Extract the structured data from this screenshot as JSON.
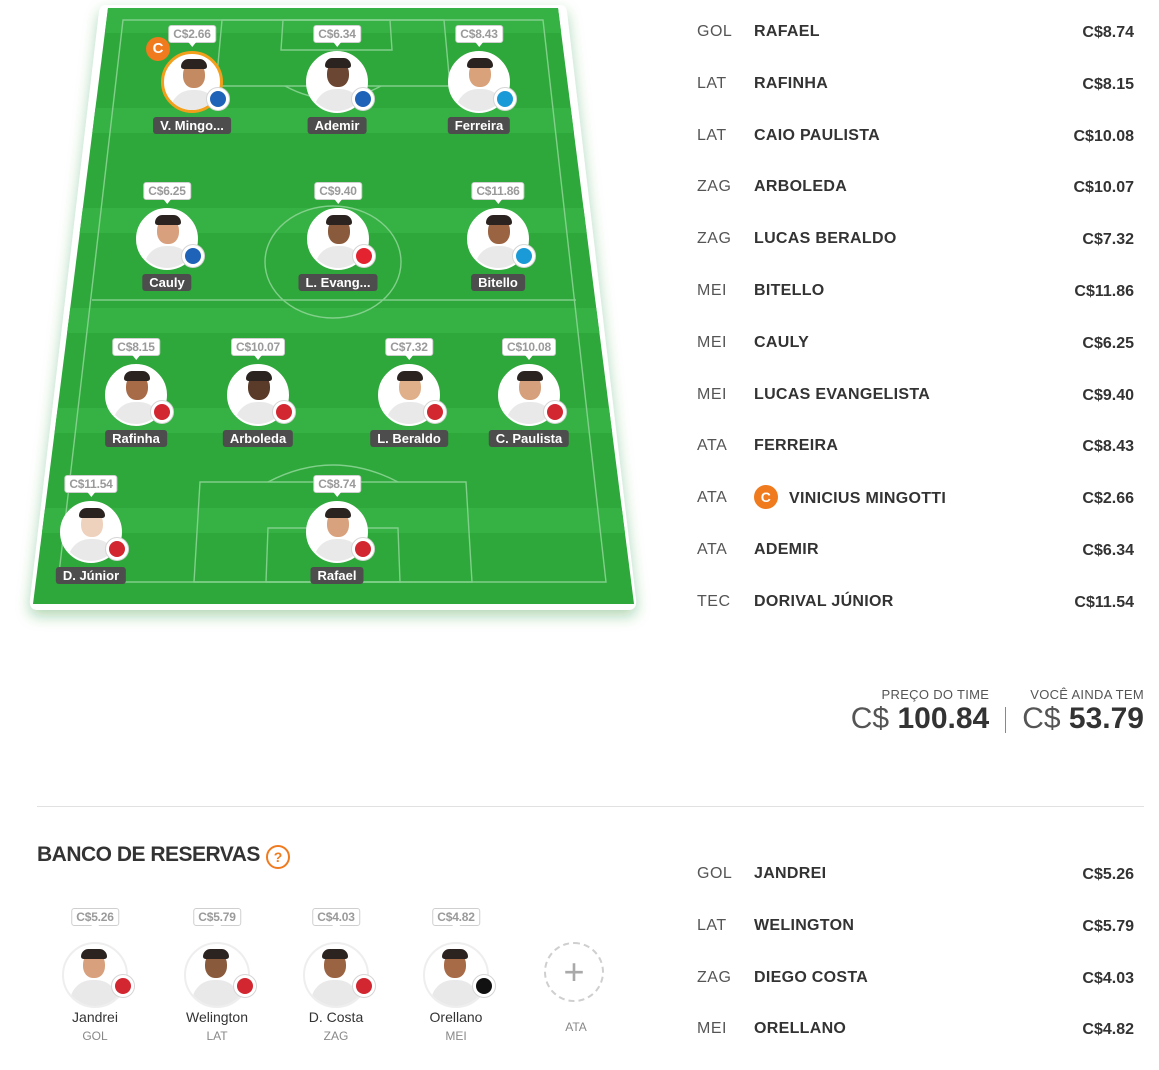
{
  "field": {
    "captain_letter": "C",
    "players": [
      {
        "key": "mingotti",
        "name": "V. Mingo...",
        "price": "C$2.66",
        "club": "bahia",
        "captain": true
      },
      {
        "key": "ademir",
        "name": "Ademir",
        "price": "C$6.34",
        "club": "bahia",
        "captain": false
      },
      {
        "key": "ferreira",
        "name": "Ferreira",
        "price": "C$8.43",
        "club": "gremio",
        "captain": false
      },
      {
        "key": "cauly",
        "name": "Cauly",
        "price": "C$6.25",
        "club": "bahia",
        "captain": false
      },
      {
        "key": "evangelista",
        "name": "L. Evang...",
        "price": "C$9.40",
        "club": "bragantino",
        "captain": false
      },
      {
        "key": "bitello",
        "name": "Bitello",
        "price": "C$11.86",
        "club": "gremio",
        "captain": false
      },
      {
        "key": "rafinha",
        "name": "Rafinha",
        "price": "C$8.15",
        "club": "spfc",
        "captain": false
      },
      {
        "key": "arboleda",
        "name": "Arboleda",
        "price": "C$10.07",
        "club": "spfc",
        "captain": false
      },
      {
        "key": "beraldo",
        "name": "L. Beraldo",
        "price": "C$7.32",
        "club": "spfc",
        "captain": false
      },
      {
        "key": "paulista",
        "name": "C. Paulista",
        "price": "C$10.08",
        "club": "spfc",
        "captain": false
      },
      {
        "key": "dorival",
        "name": "D. Júnior",
        "price": "C$11.54",
        "club": "spfc",
        "captain": false
      },
      {
        "key": "rafael",
        "name": "Rafael",
        "price": "C$8.74",
        "club": "spfc",
        "captain": false
      }
    ]
  },
  "lineup": [
    {
      "pos": "GOL",
      "name": "RAFAEL",
      "price": "C$8.74",
      "captain": false
    },
    {
      "pos": "LAT",
      "name": "RAFINHA",
      "price": "C$8.15",
      "captain": false
    },
    {
      "pos": "LAT",
      "name": "CAIO PAULISTA",
      "price": "C$10.08",
      "captain": false
    },
    {
      "pos": "ZAG",
      "name": "ARBOLEDA",
      "price": "C$10.07",
      "captain": false
    },
    {
      "pos": "ZAG",
      "name": "LUCAS BERALDO",
      "price": "C$7.32",
      "captain": false
    },
    {
      "pos": "MEI",
      "name": "BITELLO",
      "price": "C$11.86",
      "captain": false
    },
    {
      "pos": "MEI",
      "name": "CAULY",
      "price": "C$6.25",
      "captain": false
    },
    {
      "pos": "MEI",
      "name": "LUCAS EVANGELISTA",
      "price": "C$9.40",
      "captain": false
    },
    {
      "pos": "ATA",
      "name": "FERREIRA",
      "price": "C$8.43",
      "captain": false
    },
    {
      "pos": "ATA",
      "name": "VINICIUS MINGOTTI",
      "price": "C$2.66",
      "captain": true
    },
    {
      "pos": "ATA",
      "name": "ADEMIR",
      "price": "C$6.34",
      "captain": false
    },
    {
      "pos": "TEC",
      "name": "DORIVAL JÚNIOR",
      "price": "C$11.54",
      "captain": false
    }
  ],
  "totals": {
    "team_price_label": "PREÇO DO TIME",
    "team_price_currency": "C$",
    "team_price_value": "100.84",
    "remaining_label": "VOCÊ AINDA TEM",
    "remaining_currency": "C$",
    "remaining_value": "53.79"
  },
  "bench": {
    "title": "BANCO DE RESERVAS",
    "help_icon": "?",
    "players": [
      {
        "name": "Jandrei",
        "pos": "GOL",
        "price": "C$5.26",
        "club": "spfc"
      },
      {
        "name": "Welington",
        "pos": "LAT",
        "price": "C$5.79",
        "club": "spfc"
      },
      {
        "name": "D. Costa",
        "pos": "ZAG",
        "price": "C$4.03",
        "club": "spfc"
      },
      {
        "name": "Orellano",
        "pos": "MEI",
        "price": "C$4.82",
        "club": "vasco"
      }
    ],
    "add_slot": {
      "icon": "+",
      "pos": "ATA"
    },
    "list": [
      {
        "pos": "GOL",
        "name": "JANDREI",
        "price": "C$5.26"
      },
      {
        "pos": "LAT",
        "name": "WELINGTON",
        "price": "C$5.79"
      },
      {
        "pos": "ZAG",
        "name": "DIEGO COSTA",
        "price": "C$4.03"
      },
      {
        "pos": "MEI",
        "name": "ORELLANO",
        "price": "C$4.82"
      }
    ]
  },
  "colors": {
    "field_green": "#2ea83a",
    "field_light": "#3bb848",
    "captain_orange": "#f07a1e",
    "captain_ring": "#f29f1c",
    "club_bahia": "#1f63b8",
    "club_gremio": "#1a9bd7",
    "club_spfc": "#d22630",
    "club_bragantino": "#e3232f",
    "club_vasco": "#111111"
  }
}
